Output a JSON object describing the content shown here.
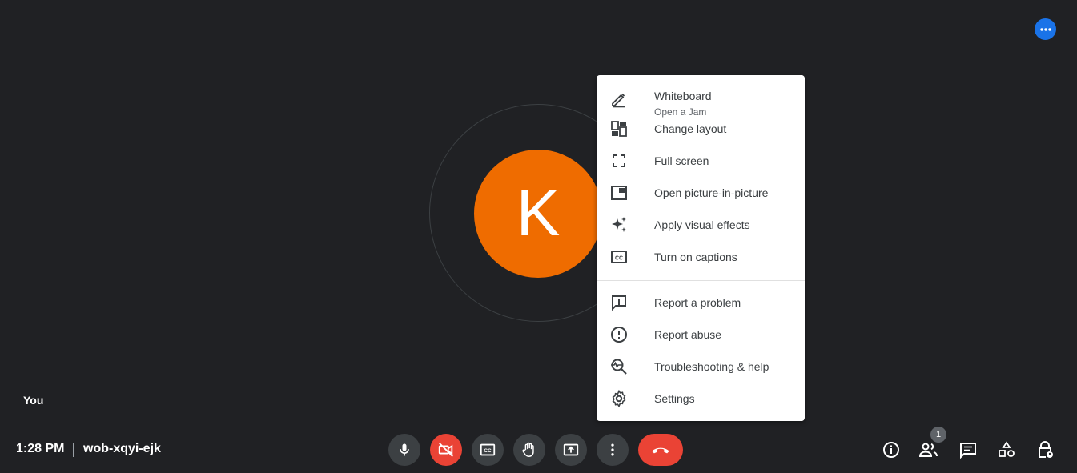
{
  "participant": {
    "initial": "K",
    "self_label": "You",
    "avatar_color": "#ef6c00"
  },
  "menu": {
    "items": [
      {
        "label": "Whiteboard",
        "sublabel": "Open a Jam",
        "icon": "pencil-icon"
      },
      {
        "label": "Change layout",
        "icon": "layout-icon"
      },
      {
        "label": "Full screen",
        "icon": "fullscreen-icon"
      },
      {
        "label": "Open picture-in-picture",
        "icon": "picture-in-picture-icon"
      },
      {
        "label": "Apply visual effects",
        "icon": "sparkle-icon"
      },
      {
        "label": "Turn on captions",
        "icon": "captions-icon"
      },
      {
        "label": "Report a problem",
        "icon": "feedback-icon"
      },
      {
        "label": "Report abuse",
        "icon": "alert-icon"
      },
      {
        "label": "Troubleshooting & help",
        "icon": "troubleshoot-icon"
      },
      {
        "label": "Settings",
        "icon": "gear-icon"
      }
    ]
  },
  "bottom_bar": {
    "time": "1:28 PM",
    "meeting_code": "wob-xqyi-ejk",
    "people_count": "1"
  },
  "colors": {
    "background": "#202124",
    "control": "#3c4043",
    "danger": "#ea4335",
    "accent": "#1a73e8"
  }
}
